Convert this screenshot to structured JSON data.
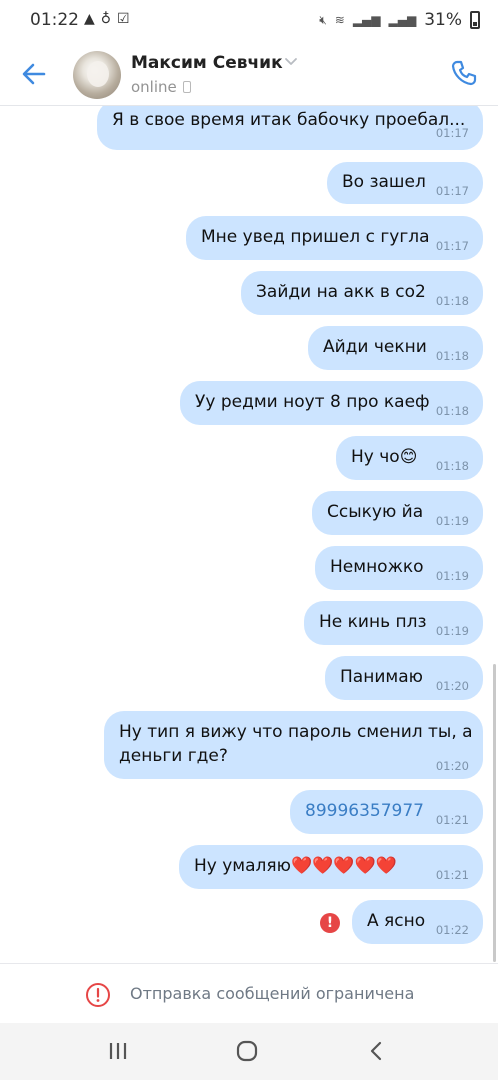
{
  "status_bar": {
    "time": "01:22",
    "battery_percent": "31%",
    "left_icons": [
      "warning-icon",
      "notification-icon",
      "download-check-icon"
    ],
    "right_icons": [
      "mute-icon",
      "wifi-calling-icon",
      "signal-icon",
      "signal-icon"
    ]
  },
  "header": {
    "contact_name": "Максим Севчик",
    "status": "online",
    "accent_color": "#3f8ae0"
  },
  "messages": [
    {
      "text": "Я в свое время итак бабочку проебал...",
      "time": "01:17"
    },
    {
      "text": "Во зашел",
      "time": "01:17"
    },
    {
      "text": "Мне увед пришел с гугла",
      "time": "01:17"
    },
    {
      "text": "Зайди на акк в со2",
      "time": "01:18"
    },
    {
      "text": "Айди чекни",
      "time": "01:18"
    },
    {
      "text": "Уу редми ноут 8 про каеф",
      "time": "01:18"
    },
    {
      "text": "Ну чо😊",
      "time": "01:18"
    },
    {
      "text": "Ссыкую йа",
      "time": "01:19"
    },
    {
      "text": "Немножко",
      "time": "01:19"
    },
    {
      "text": "Не кинь плз",
      "time": "01:19"
    },
    {
      "text": "Панимаю",
      "time": "01:20"
    },
    {
      "text": "Ну тип я вижу что пароль сменил ты, а деньги где?",
      "time": "01:20"
    },
    {
      "text": "89996357977",
      "time": "01:21"
    },
    {
      "text": "Ну умаляю❤️❤️❤️❤️❤️",
      "time": "01:21"
    },
    {
      "text": "А ясно",
      "time": "01:22",
      "failed": true
    }
  ],
  "restriction": {
    "text": "Отправка сообщений ограничена",
    "icon": "alert-circle-icon",
    "color": "#e64646"
  },
  "navbar": {
    "buttons": [
      "recent-apps-icon",
      "home-icon",
      "back-icon"
    ]
  },
  "colors": {
    "bubble": "#cce4ff",
    "link": "#3a7dc4",
    "time": "#7d93ab"
  }
}
